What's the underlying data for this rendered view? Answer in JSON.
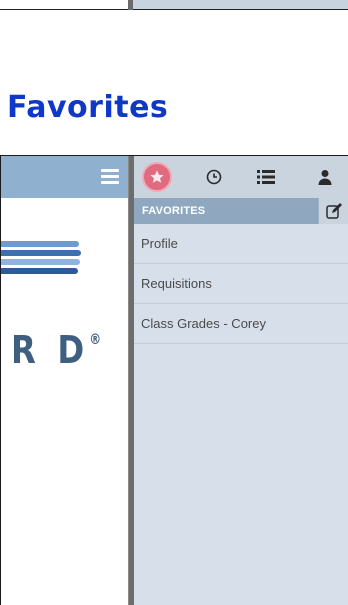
{
  "heading": "Favorites",
  "favorites_panel": {
    "header_label": "FAVORITES",
    "items": [
      "Profile",
      "Requisitions",
      "Class Grades - Corey"
    ]
  },
  "logo": {
    "text": "R D",
    "registered": "®"
  },
  "icons": {
    "menu": "hamburger-menu-icon",
    "favorites": "star-icon",
    "history": "clock-icon",
    "list": "list-icon",
    "user": "user-icon",
    "edit": "edit-icon"
  },
  "colors": {
    "heading": "#1038c8",
    "toolbar": "#8fb0cf",
    "favorites_header": "#8fa8c0",
    "panel_bg": "#d7e0ea",
    "star_button": "#e06a7f"
  }
}
